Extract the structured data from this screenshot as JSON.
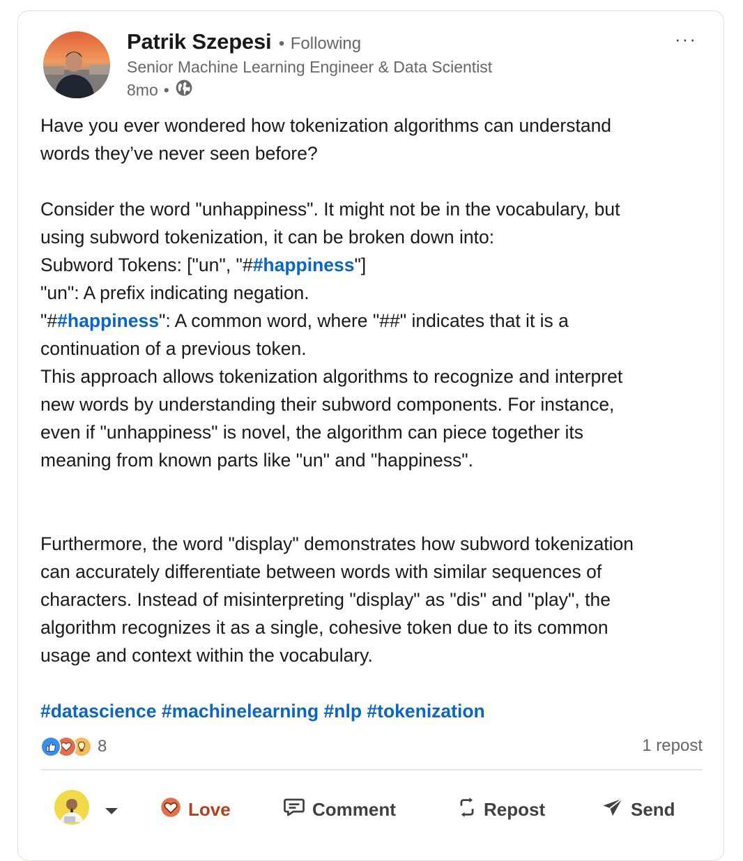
{
  "author": {
    "name": "Patrik Szepesi",
    "separator": "•",
    "follow_status": "Following",
    "headline": "Senior Machine Learning Engineer & Data Scientist",
    "time_ago": "8mo",
    "meta_separator": "•",
    "visibility_icon": "globe-icon"
  },
  "menu": {
    "more_label": "···"
  },
  "post": {
    "p1": "Have you ever wondered how tokenization algorithms can understand",
    "p2": "words they’ve never seen before?",
    "p3": "Consider the word \"unhappiness\". It might not be in the vocabulary, but",
    "p4": "using subword tokenization, it can be broken down into:",
    "p5_pre": "Subword Tokens: [\"un\", \"#",
    "p5_tag": "#happiness",
    "p5_post": "\"]",
    "p6": "\"un\": A prefix indicating negation.",
    "p7_pre": "\"#",
    "p7_tag": "#happiness",
    "p7_post": "\": A common word, where \"##\" indicates that it is a",
    "p8": "continuation of a previous token.",
    "p9": "This approach allows tokenization algorithms to recognize and interpret",
    "p10": "new words by understanding their subword components. For instance,",
    "p11": "even if \"unhappiness\" is novel, the algorithm can piece together its",
    "p12": "meaning from known parts like \"un\" and \"happiness\".",
    "p13": "Furthermore, the word \"display\" demonstrates how subword tokenization",
    "p14": "can accurately differentiate between words with similar sequences of",
    "p15": "characters. Instead of misinterpreting \"display\" as \"dis\" and \"play\", the",
    "p16": "algorithm recognizes it as a single, cohesive token due to its common",
    "p17": "usage and context within the vocabulary.",
    "hashtags": [
      "#datascience",
      "#machinelearning",
      "#nlp",
      "#tokenization"
    ]
  },
  "social": {
    "reaction_icons": [
      "like-icon",
      "love-icon",
      "insightful-icon"
    ],
    "reaction_count": "8",
    "repost_count": "1 repost"
  },
  "actions": {
    "love_label": "Love",
    "comment_label": "Comment",
    "repost_label": "Repost",
    "send_label": "Send"
  },
  "colors": {
    "link": "#0a66c2",
    "love": "#b24020",
    "secondary_text": "#666666",
    "like": "#378fe9",
    "insightful": "#f5bb5c"
  }
}
